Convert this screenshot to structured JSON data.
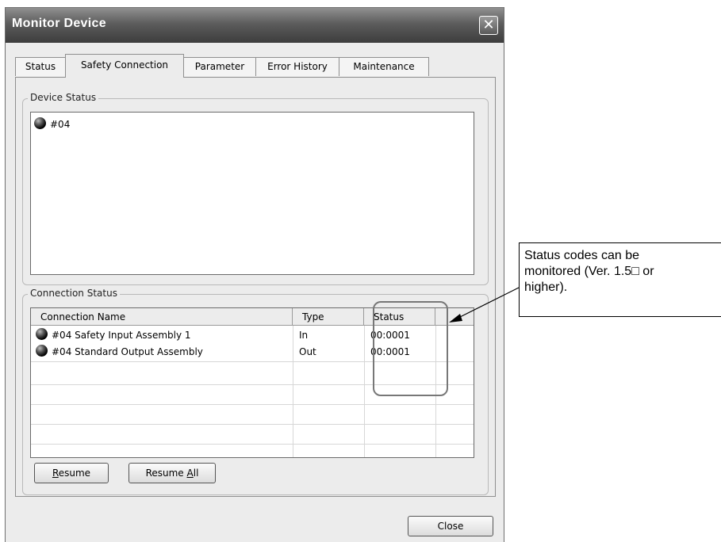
{
  "window": {
    "title": "Monitor Device",
    "close_glyph": "✕"
  },
  "tabs": [
    {
      "label": "Status",
      "active": false
    },
    {
      "label": "Safety Connection",
      "active": true
    },
    {
      "label": "Parameter",
      "active": false
    },
    {
      "label": "Error History",
      "active": false
    },
    {
      "label": "Maintenance",
      "active": false
    }
  ],
  "device_status": {
    "group_label": "Device Status",
    "items": [
      {
        "icon": "status-dot-icon",
        "label": "#04"
      }
    ]
  },
  "connection_status": {
    "group_label": "Connection Status",
    "columns": [
      "Connection Name",
      "Type",
      "Status"
    ],
    "rows": [
      {
        "icon": "status-dot-icon",
        "name": "#04 Safety Input Assembly 1",
        "type": "In",
        "status": "00:0001"
      },
      {
        "icon": "status-dot-icon",
        "name": "#04 Standard Output Assembly",
        "type": "Out",
        "status": "00:0001"
      }
    ]
  },
  "buttons": {
    "resume_pre": "",
    "resume_key": "R",
    "resume_post": "esume",
    "resume_all_pre": "Resume ",
    "resume_all_key": "A",
    "resume_all_post": "ll",
    "close": "Close"
  },
  "callout": {
    "line1": "Status codes can be",
    "line2": "monitored (Ver. 1.5□ or",
    "line3": "higher)."
  }
}
